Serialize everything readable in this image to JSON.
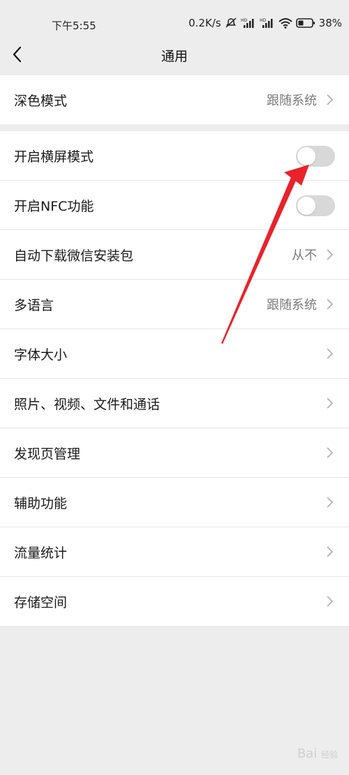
{
  "status_bar": {
    "time": "下午5:55",
    "network_speed": "0.2K/s",
    "battery": "38%",
    "icons": [
      "mute-icon",
      "signal-hd-icon",
      "signal-hd-icon",
      "wifi-icon",
      "battery-icon"
    ]
  },
  "header": {
    "title": "通用",
    "back_icon": "chevron-left-icon"
  },
  "section1": {
    "items": [
      {
        "label": "深色模式",
        "value": "跟随系统"
      }
    ]
  },
  "section2": {
    "items": [
      {
        "label": "开启横屏模式",
        "toggle": false
      },
      {
        "label": "开启NFC功能",
        "toggle": false
      },
      {
        "label": "自动下载微信安装包",
        "value": "从不"
      },
      {
        "label": "多语言",
        "value": "跟随系统"
      },
      {
        "label": "字体大小"
      },
      {
        "label": "照片、视频、文件和通话"
      },
      {
        "label": "发现页管理"
      },
      {
        "label": "辅助功能"
      },
      {
        "label": "流量统计"
      },
      {
        "label": "存储空间"
      }
    ]
  },
  "annotation": {
    "color": "#e8232a"
  },
  "watermark": {
    "text": "Bai",
    "sub": "经验"
  }
}
